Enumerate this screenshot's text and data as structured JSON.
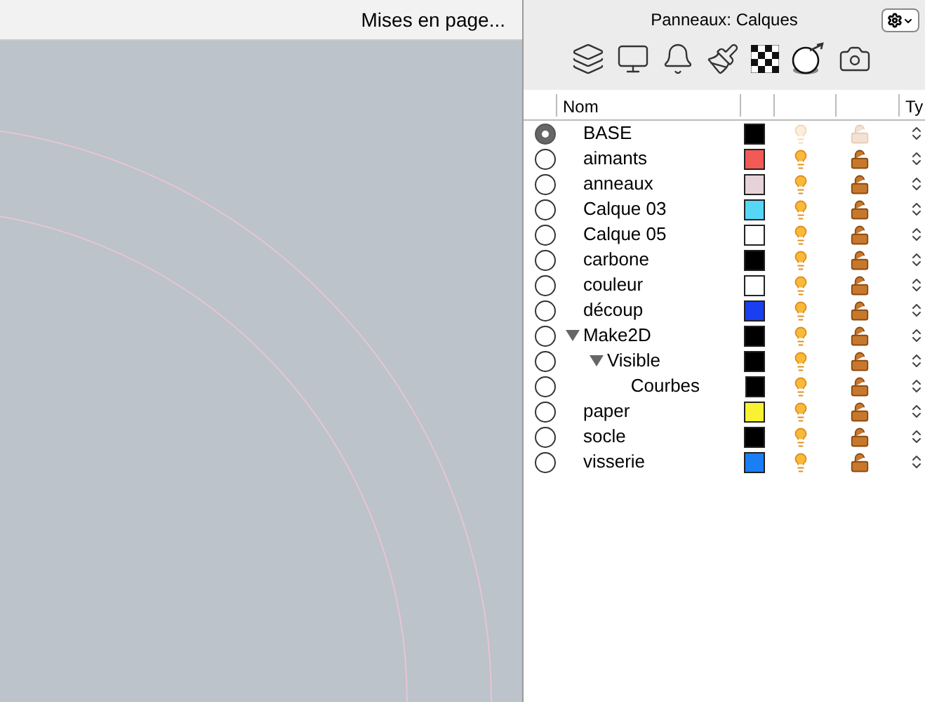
{
  "document": {
    "menu_label": "Mises en page..."
  },
  "panel": {
    "title": "Panneaux: Calques",
    "columns": [
      "Nom",
      "Ty"
    ],
    "layers": [
      {
        "name": "BASE",
        "color": "#000000",
        "selected": true
      },
      {
        "name": "aimants",
        "color": "#f25a55",
        "selected": false
      },
      {
        "name": "anneaux",
        "color": "#e6d2d8",
        "selected": false
      },
      {
        "name": "Calque 03",
        "color": "#55d7f5",
        "selected": false
      },
      {
        "name": "Calque 05",
        "color": "#ffffff",
        "selected": false
      },
      {
        "name": "carbone",
        "color": "#000000",
        "selected": false
      },
      {
        "name": "couleur",
        "color": "#ffffff",
        "selected": false
      },
      {
        "name": "découp",
        "color": "#1a3ff0",
        "selected": false
      },
      {
        "name": "Make2D",
        "color": "#000000",
        "selected": false,
        "expanded": true,
        "children": [
          {
            "name": "Visible",
            "color": "#000000",
            "selected": false,
            "expanded": true,
            "children": [
              {
                "name": "Courbes",
                "color": "#000000",
                "selected": false
              }
            ]
          }
        ]
      },
      {
        "name": "paper",
        "color": "#f8f232",
        "selected": false
      },
      {
        "name": "socle",
        "color": "#000000",
        "selected": false
      },
      {
        "name": "visserie",
        "color": "#1a7ef5",
        "selected": false
      }
    ]
  }
}
